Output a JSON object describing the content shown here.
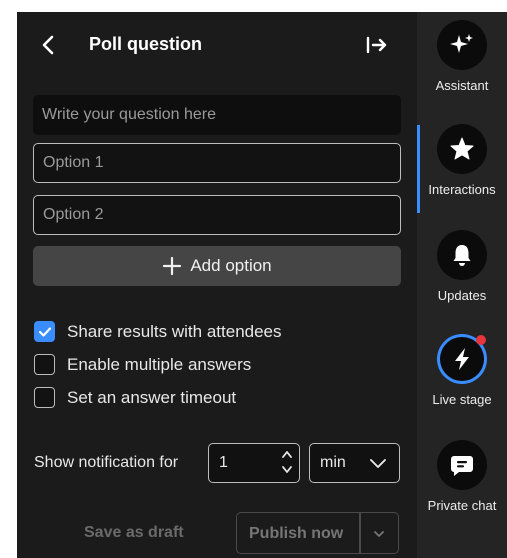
{
  "header": {
    "title": "Poll question"
  },
  "form": {
    "question_placeholder": "Write your question here",
    "option1_placeholder": "Option 1",
    "option2_placeholder": "Option 2",
    "add_option_label": "Add option"
  },
  "settings": {
    "share_results": {
      "label": "Share results with attendees",
      "checked": true
    },
    "multiple_answers": {
      "label": "Enable multiple answers",
      "checked": false
    },
    "answer_timeout": {
      "label": "Set an answer timeout",
      "checked": false
    }
  },
  "notification": {
    "label": "Show notification for",
    "value": "1",
    "unit": "min"
  },
  "footer": {
    "save_draft_label": "Save as draft",
    "publish_label": "Publish now"
  },
  "rail": {
    "items": [
      {
        "label": "Assistant",
        "icon": "sparkle-icon"
      },
      {
        "label": "Interactions",
        "icon": "star-icon",
        "active": true
      },
      {
        "label": "Updates",
        "icon": "bell-icon"
      },
      {
        "label": "Live stage",
        "icon": "lightning-icon"
      },
      {
        "label": "Private chat",
        "icon": "chat-icon"
      }
    ]
  },
  "colors": {
    "panel_bg": "#1b1b1b",
    "rail_bg": "#242424",
    "accent": "#3a8dff",
    "live_dot": "#e8343c"
  }
}
